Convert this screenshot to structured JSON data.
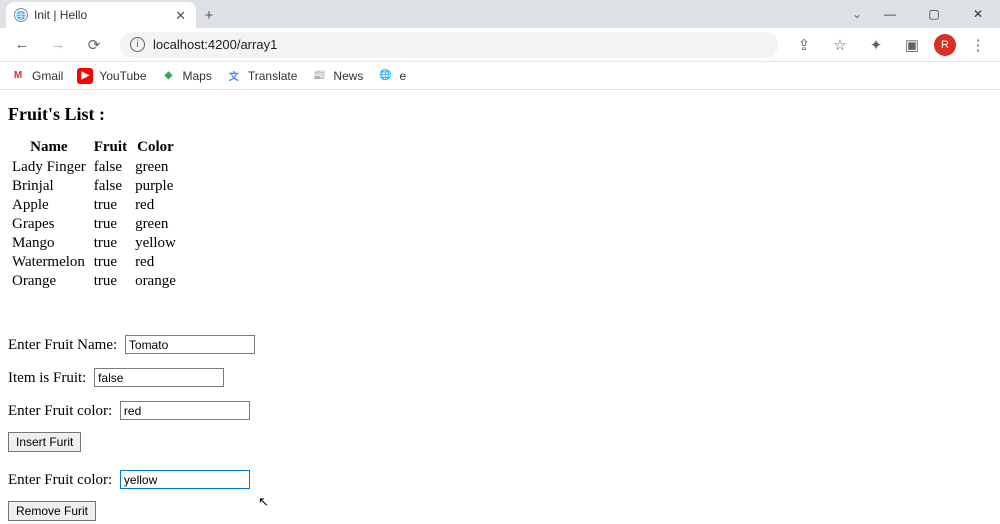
{
  "browser": {
    "tab_title": "Init | Hello",
    "url": "localhost:4200/array1",
    "bookmarks": [
      {
        "icon": "M",
        "bg": "#fff",
        "color": "#d93025",
        "label": "Gmail"
      },
      {
        "icon": "▶",
        "bg": "#ff0000",
        "color": "#fff",
        "label": "YouTube"
      },
      {
        "icon": "◆",
        "bg": "#fff",
        "color": "#34a853",
        "label": "Maps"
      },
      {
        "icon": "文",
        "bg": "#fff",
        "color": "#4285f4",
        "label": "Translate"
      },
      {
        "icon": "📰",
        "bg": "#fff",
        "color": "#4285f4",
        "label": "News"
      },
      {
        "icon": "🌐",
        "bg": "#fff",
        "color": "#5f6368",
        "label": "e"
      }
    ],
    "avatar_initial": "R"
  },
  "page": {
    "heading": "Fruit's List :",
    "columns": [
      "Name",
      "Fruit",
      "Color"
    ],
    "rows": [
      {
        "name": "Lady Finger",
        "fruit": "false",
        "color": "green"
      },
      {
        "name": "Brinjal",
        "fruit": "false",
        "color": "purple"
      },
      {
        "name": "Apple",
        "fruit": "true",
        "color": "red"
      },
      {
        "name": "Grapes",
        "fruit": "true",
        "color": "green"
      },
      {
        "name": "Mango",
        "fruit": "true",
        "color": "yellow"
      },
      {
        "name": "Watermelon",
        "fruit": "true",
        "color": "red"
      },
      {
        "name": "Orange",
        "fruit": "true",
        "color": "orange"
      }
    ],
    "insert": {
      "name_label": "Enter Fruit Name:",
      "name_value": "Tomato",
      "fruit_label": "Item is Fruit:",
      "fruit_value": "false",
      "color_label": "Enter Fruit color:",
      "color_value": "red",
      "button": "Insert Furit"
    },
    "remove": {
      "color_label": "Enter Fruit color:",
      "color_value": "yellow",
      "button": "Remove Furit"
    }
  }
}
